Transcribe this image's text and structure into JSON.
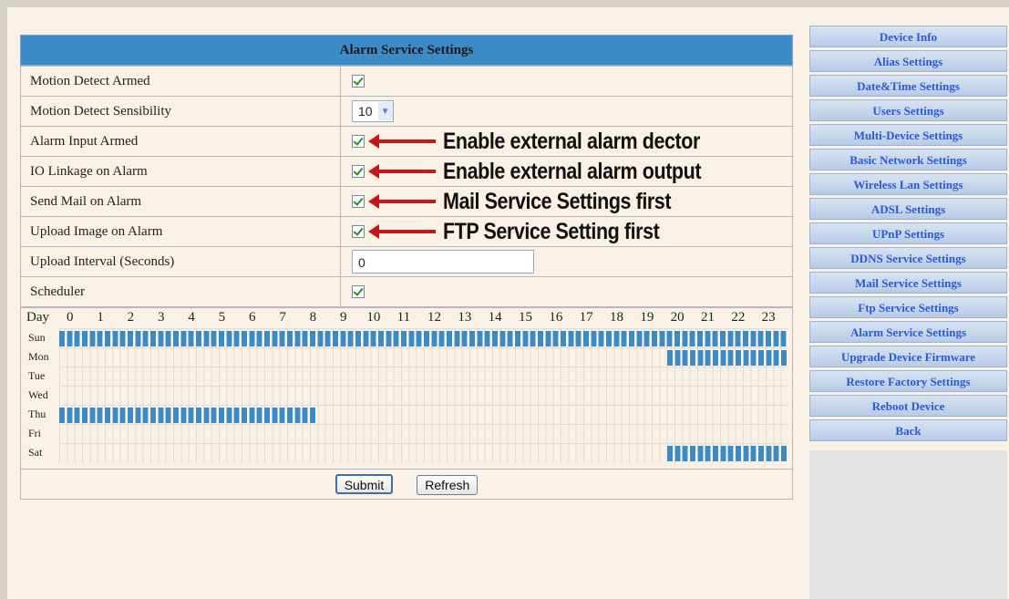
{
  "main": {
    "title": "Alarm Service Settings",
    "rows": [
      {
        "label": "Motion Detect Armed"
      },
      {
        "label": "Motion Detect Sensibility",
        "select_value": "10"
      },
      {
        "label": "Alarm Input Armed",
        "annotation": "Enable external alarm dector"
      },
      {
        "label": "IO Linkage on Alarm",
        "annotation": "Enable external alarm output"
      },
      {
        "label": "Send Mail on Alarm",
        "annotation": "Mail Service Settings first"
      },
      {
        "label": "Upload Image on Alarm",
        "annotation": "FTP Service Setting first"
      },
      {
        "label": "Upload Interval (Seconds)",
        "input_value": "0"
      },
      {
        "label": "Scheduler"
      }
    ],
    "schedule": {
      "header": "Day",
      "hours": [
        "0",
        "1",
        "2",
        "3",
        "4",
        "5",
        "6",
        "7",
        "8",
        "9",
        "10",
        "11",
        "12",
        "13",
        "14",
        "15",
        "16",
        "17",
        "18",
        "19",
        "20",
        "21",
        "22",
        "23"
      ],
      "days": [
        {
          "label": "Sun",
          "ranges": [
            [
              0,
              24
            ]
          ]
        },
        {
          "label": "Mon",
          "ranges": [
            [
              20,
              24
            ]
          ]
        },
        {
          "label": "Tue",
          "ranges": []
        },
        {
          "label": "Wed",
          "ranges": []
        },
        {
          "label": "Thu",
          "ranges": [
            [
              0,
              8.5
            ]
          ]
        },
        {
          "label": "Fri",
          "ranges": []
        },
        {
          "label": "Sat",
          "ranges": [
            [
              20,
              24
            ]
          ]
        }
      ]
    },
    "buttons": {
      "submit": "Submit",
      "refresh": "Refresh"
    }
  },
  "sidebar": {
    "items": [
      "Device Info",
      "Alias Settings",
      "Date&Time Settings",
      "Users Settings",
      "Multi-Device Settings",
      "Basic Network Settings",
      "Wireless Lan Settings",
      "ADSL Settings",
      "UPnP Settings",
      "DDNS Service Settings",
      "Mail Service Settings",
      "Ftp Service Settings",
      "Alarm Service Settings",
      "Upgrade Device Firmware",
      "Restore Factory Settings",
      "Reboot Device",
      "Back"
    ]
  },
  "colors": {
    "header": "#3d8bc6",
    "schedule_fill": "#3d89c3",
    "annotation_arrow": "#c31818",
    "nav_text": "#2a5bd6"
  }
}
